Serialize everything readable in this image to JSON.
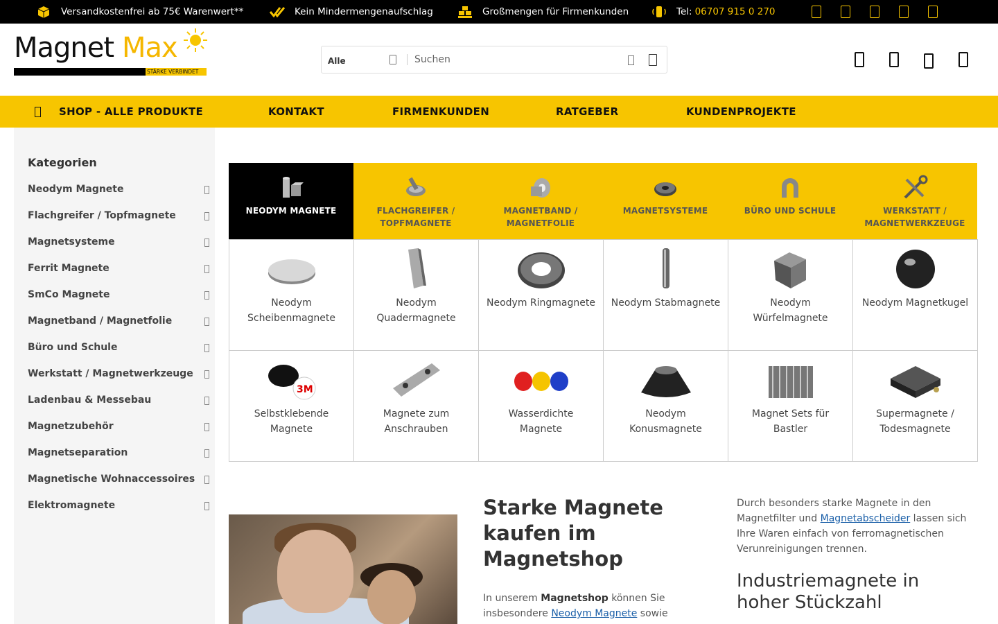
{
  "topbar": {
    "usps": [
      {
        "text": "Versandkostenfrei ab 75€ Warenwert**",
        "icon": "box-icon"
      },
      {
        "text": "Kein Mindermengenaufschlag",
        "icon": "check-icon"
      },
      {
        "text": "Großmengen für Firmenkunden",
        "icon": "pallet-icon"
      }
    ],
    "phone_label": "Tel:",
    "phone_number": "06707 915 0 270",
    "social_icons": [
      "facebook-icon",
      "instagram-icon",
      "youtube-icon",
      "pinterest-icon",
      "xing-icon"
    ]
  },
  "logo": {
    "word1": "Magnet",
    "word2": "Max",
    "tagline": "STÄRKE VERBINDET"
  },
  "search": {
    "category": "Alle",
    "placeholder": "Suchen"
  },
  "header_icons": [
    "account-icon",
    "wishlist-icon",
    "compare-icon",
    "cart-icon"
  ],
  "nav": {
    "items": [
      "SHOP - ALLE PRODUKTE",
      "KONTAKT",
      "FIRMENKUNDEN",
      "RATGEBER",
      "KUNDENPROJEKTE"
    ]
  },
  "sidebar": {
    "title": "Kategorien",
    "items": [
      "Neodym Magnete",
      "Flachgreifer / Topfmagnete",
      "Magnetsysteme",
      "Ferrit Magnete",
      "SmCo Magnete",
      "Magnetband / Magnetfolie",
      "Büro und Schule",
      "Werkstatt / Magnetwerkzeuge",
      "Ladenbau & Messebau",
      "Magnetzubehör",
      "Magnetseparation",
      "Magnetische Wohnaccessoires",
      "Elektromagnete"
    ]
  },
  "tabs": [
    {
      "label": "NEODYM MAGNETE",
      "active": true
    },
    {
      "label": "FLACHGREIFER / TOPFMAGNETE",
      "active": false
    },
    {
      "label": "MAGNETBAND / MAGNETFOLIE",
      "active": false
    },
    {
      "label": "MAGNETSYSTEME",
      "active": false
    },
    {
      "label": "BÜRO UND SCHULE",
      "active": false
    },
    {
      "label": "WERKSTATT / MAGNETWERKZEUGE",
      "active": false
    }
  ],
  "products": [
    "Neodym Scheibenmagnete",
    "Neodym Quadermagnete",
    "Neodym Ringmagnete",
    "Neodym Stabmagnete",
    "Neodym Würfelmagnete",
    "Neodym Magnetkugel",
    "Selbstklebende Magnete",
    "Magnete zum Anschrauben",
    "Wasserdichte Magnete",
    "Neodym Konusmagnete",
    "Magnet Sets für Bastler",
    "Supermagnete / Todesmagnete"
  ],
  "content": {
    "heading": "Starke Magnete kaufen im Magnetshop",
    "intro_pre": "In unserem ",
    "intro_bold": "Magnetshop",
    "intro_mid": " können Sie insbesondere ",
    "intro_link": "Neodym Magnete",
    "intro_post": " sowie",
    "para_pre": "Durch besonders starke Magnete in den Magnetfilter und ",
    "para_link": "Magnetabscheider",
    "para_post": " lassen sich Ihre Waren einfach von ferromagnetischen Verunreinigungen trennen.",
    "heading2": "Industriemagnete in hoher Stückzahl"
  },
  "colors": {
    "brand_yellow": "#f7c500",
    "black": "#000000",
    "link": "#1a5fa8"
  }
}
